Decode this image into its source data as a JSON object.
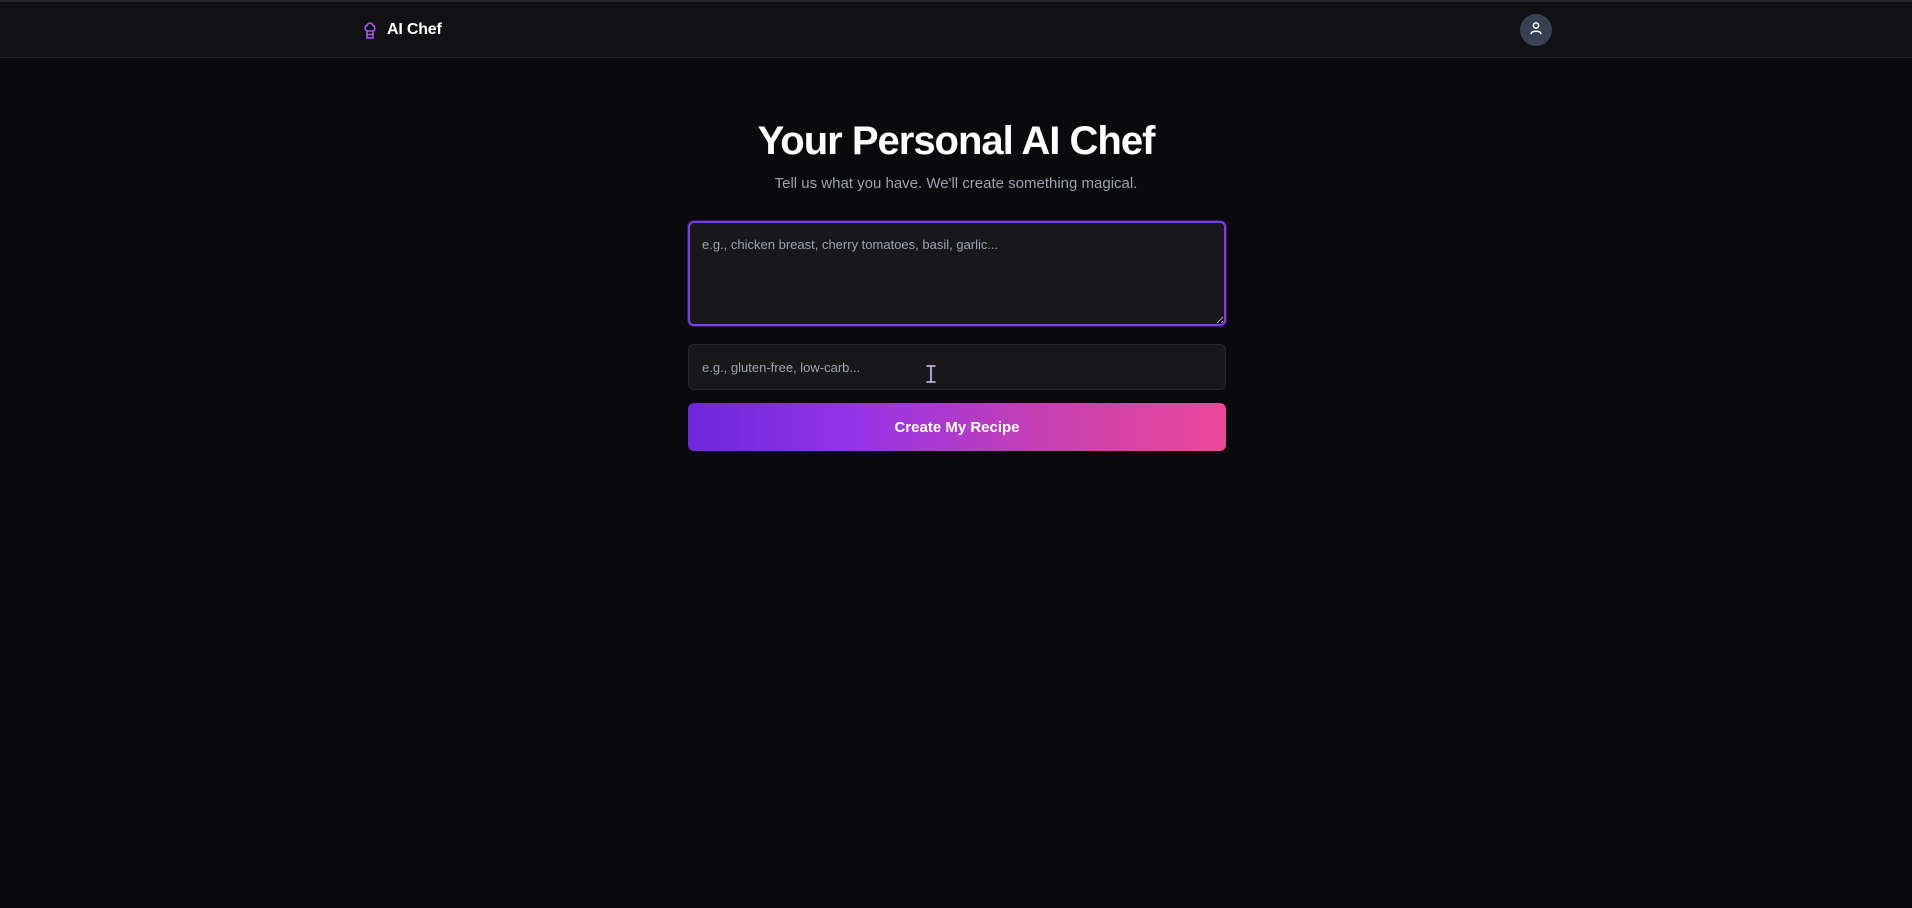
{
  "navbar": {
    "brand_name": "AI Chef",
    "brand_icon": "chef-hat-icon",
    "avatar_icon": "user-icon",
    "brand_color": "#a855f7"
  },
  "hero": {
    "title": "Your Personal AI Chef",
    "subtitle": "Tell us what you have. We'll create something magical."
  },
  "form": {
    "ingredients_placeholder": "e.g., chicken breast, cherry tomatoes, basil, garlic...",
    "ingredients_value": "",
    "dietary_placeholder": "e.g., gluten-free, low-carb...",
    "dietary_value": "",
    "submit_label": "Create My Recipe"
  },
  "colors": {
    "background": "#0a0a0c",
    "accent_start": "#6d28d9",
    "accent_end": "#ec4899",
    "focus_border": "#7c3aed"
  }
}
